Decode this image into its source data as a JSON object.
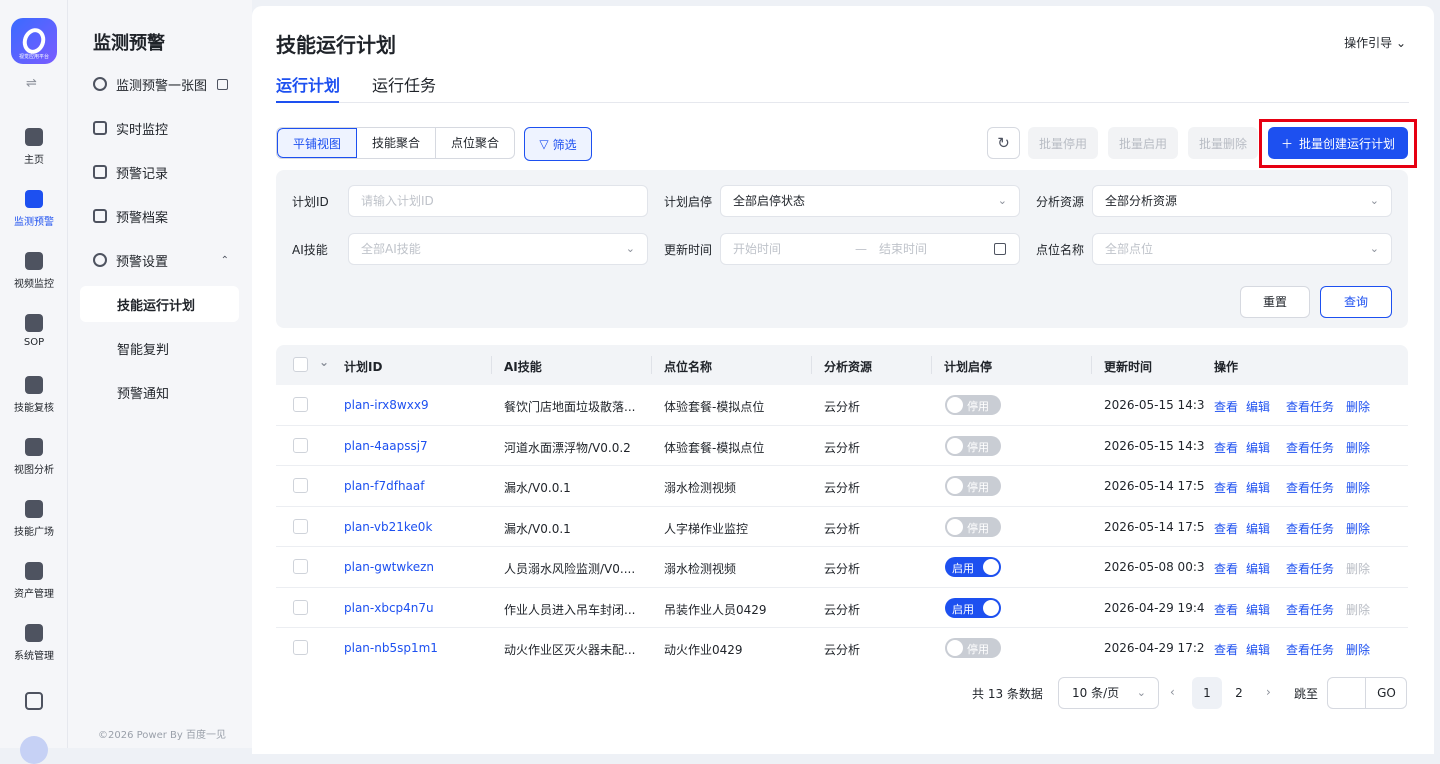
{
  "rail": {
    "logo_sub": "视觉应用平台",
    "items": [
      {
        "label": "主页",
        "icon": "home-icon"
      },
      {
        "label": "监测预警",
        "icon": "chart-line-icon",
        "active": true
      },
      {
        "label": "视频监控",
        "icon": "camera-icon"
      },
      {
        "label": "SOP",
        "icon": "sop-icon"
      },
      {
        "label": "技能复核",
        "icon": "review-icon"
      },
      {
        "label": "视图分析",
        "icon": "monitor-icon"
      },
      {
        "label": "技能广场",
        "icon": "plaza-icon"
      },
      {
        "label": "资产管理",
        "icon": "asset-icon"
      },
      {
        "label": "系统管理",
        "icon": "system-icon"
      }
    ]
  },
  "menu": {
    "title": "监测预警",
    "items": [
      {
        "label": "监测预警一张图"
      },
      {
        "label": "实时监控"
      },
      {
        "label": "预警记录"
      },
      {
        "label": "预警档案"
      },
      {
        "label": "预警设置"
      },
      {
        "label": "技能运行计划"
      },
      {
        "label": "智能复判"
      },
      {
        "label": "预警通知"
      }
    ],
    "copyright": "©2026 Power By 百度一见"
  },
  "header": {
    "title": "技能运行计划",
    "guide": "操作引导 ⌄",
    "tabs": [
      "运行计划",
      "运行任务"
    ]
  },
  "toolbar": {
    "views": [
      "平铺视图",
      "技能聚合",
      "点位聚合"
    ],
    "filter": "筛选",
    "batch_stop": "批量停用",
    "batch_start": "批量启用",
    "batch_delete": "批量删除",
    "batch_create": "批量创建运行计划"
  },
  "filters": {
    "plan_id_label": "计划ID",
    "plan_id_placeholder": "请输入计划ID",
    "status_label": "计划启停",
    "status_value": "全部启停状态",
    "resource_label": "分析资源",
    "resource_value": "全部分析资源",
    "skill_label": "AI技能",
    "skill_placeholder": "全部AI技能",
    "time_label": "更新时间",
    "time_start": "开始时间",
    "time_sep": "—",
    "time_end": "结束时间",
    "point_label": "点位名称",
    "point_placeholder": "全部点位",
    "reset": "重置",
    "query": "查询"
  },
  "table": {
    "columns": [
      "计划ID",
      "AI技能",
      "点位名称",
      "分析资源",
      "计划启停",
      "更新时间",
      "操作"
    ],
    "actions": [
      "查看",
      "编辑",
      "查看任务",
      "删除"
    ],
    "rows": [
      {
        "id": "plan-irx8wxx9",
        "skill": "餐饮门店地面垃圾散落...",
        "point": "体验套餐-模拟点位",
        "resource": "云分析",
        "status": "停用",
        "updated": "2026-05-15 14:3"
      },
      {
        "id": "plan-4aapssj7",
        "skill": "河道水面漂浮物/V0.0.2",
        "point": "体验套餐-模拟点位",
        "resource": "云分析",
        "status": "停用",
        "updated": "2026-05-15 14:3"
      },
      {
        "id": "plan-f7dfhaaf",
        "skill": "漏水/V0.0.1",
        "point": "溺水检测视频",
        "resource": "云分析",
        "status": "停用",
        "updated": "2026-05-14 17:5"
      },
      {
        "id": "plan-vb21ke0k",
        "skill": "漏水/V0.0.1",
        "point": "人字梯作业监控",
        "resource": "云分析",
        "status": "停用",
        "updated": "2026-05-14 17:5"
      },
      {
        "id": "plan-gwtwkezn",
        "skill": "人员溺水风险监测/V0....",
        "point": "溺水检测视频",
        "resource": "云分析",
        "status": "启用",
        "updated": "2026-05-08 00:3"
      },
      {
        "id": "plan-xbcp4n7u",
        "skill": "作业人员进入吊车封闭...",
        "point": "吊装作业人员0429",
        "resource": "云分析",
        "status": "启用",
        "updated": "2026-04-29 19:4"
      },
      {
        "id": "plan-nb5sp1m1",
        "skill": "动火作业区灭火器未配...",
        "point": "动火作业0429",
        "resource": "云分析",
        "status": "停用",
        "updated": "2026-04-29 17:2"
      }
    ]
  },
  "pager": {
    "total": "共 13 条数据",
    "size": "10 条/页",
    "prev": "‹",
    "next": "›",
    "pages": [
      "1",
      "2"
    ],
    "jump": "跳至",
    "go": "GO"
  },
  "colors": {
    "accent": "#1d50f0",
    "highlight_box": "#e60012"
  }
}
